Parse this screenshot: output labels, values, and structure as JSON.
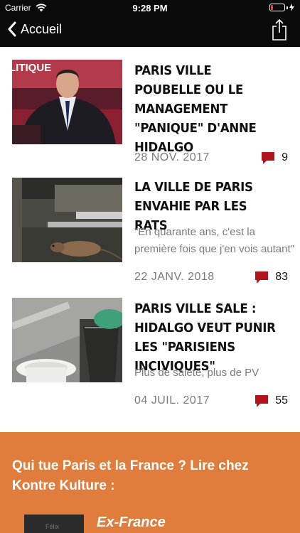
{
  "status_bar": {
    "carrier": "Carrier",
    "time": "9:28 PM"
  },
  "nav": {
    "back_label": "Accueil"
  },
  "articles": [
    {
      "title": "PARIS VILLE POUBELLE OU LE MANAGEMENT \"PANIQUE\" D'ANNE HIDALGO",
      "excerpt": "",
      "date": "28 NOV. 2017",
      "comments": "9"
    },
    {
      "title": "LA VILLE DE PARIS ENVAHIE PAR LES RATS",
      "excerpt": "\"En quarante ans, c'est la première fois que j'en vois autant\"",
      "date": "22 JANV. 2018",
      "comments": "83"
    },
    {
      "title": "PARIS VILLE SALE : HIDALGO VEUT PUNIR LES \"PARISIENS INCIVIQUES\"",
      "excerpt": "Plus de saleté, plus de PV",
      "date": "04 JUIL. 2017",
      "comments": "55"
    }
  ],
  "promo": {
    "title": "Qui tue Paris et la France ? Lire chez Kontre Kulture :",
    "book_cover_text": "Félix",
    "book_title": "Ex-France"
  },
  "colors": {
    "bar_bg": "#0a0a0a",
    "comment_icon": "#b3141b",
    "promo_bg": "#e07d3c",
    "meta_text": "#7a7a7a"
  }
}
